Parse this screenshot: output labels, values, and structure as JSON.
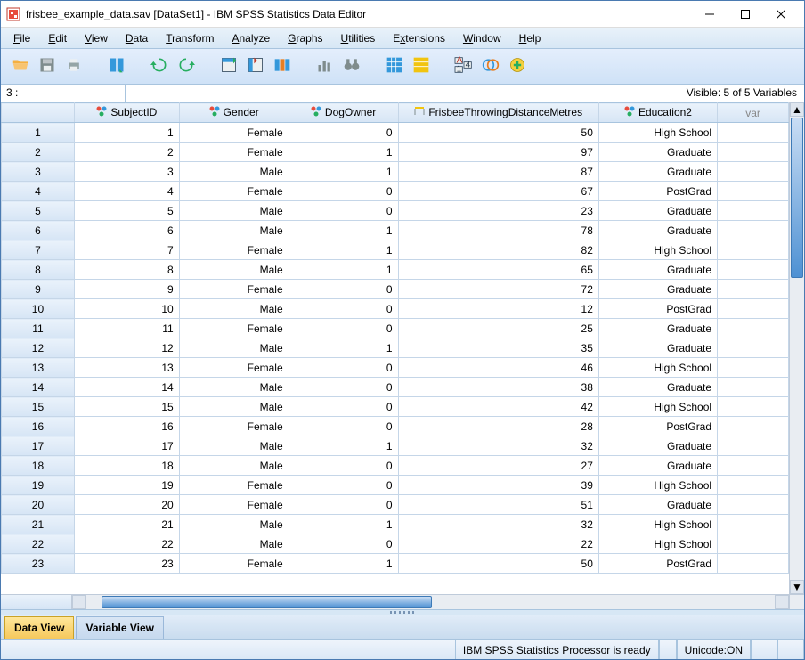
{
  "window": {
    "title": "frisbee_example_data.sav [DataSet1] - IBM SPSS Statistics Data Editor"
  },
  "menu": [
    "File",
    "Edit",
    "View",
    "Data",
    "Transform",
    "Analyze",
    "Graphs",
    "Utilities",
    "Extensions",
    "Window",
    "Help"
  ],
  "info": {
    "cell_address": "3 :",
    "visible": "Visible: 5 of 5 Variables"
  },
  "columns": [
    {
      "name": "SubjectID",
      "type": "nominal"
    },
    {
      "name": "Gender",
      "type": "nominal"
    },
    {
      "name": "DogOwner",
      "type": "nominal"
    },
    {
      "name": "FrisbeeThrowingDistanceMetres",
      "type": "scale"
    },
    {
      "name": "Education2",
      "type": "nominal"
    }
  ],
  "var_header": "var",
  "rows": [
    {
      "n": "1",
      "SubjectID": "1",
      "Gender": "Female",
      "DogOwner": "0",
      "Frisbee": "50",
      "Education2": "High School"
    },
    {
      "n": "2",
      "SubjectID": "2",
      "Gender": "Female",
      "DogOwner": "1",
      "Frisbee": "97",
      "Education2": "Graduate"
    },
    {
      "n": "3",
      "SubjectID": "3",
      "Gender": "Male",
      "DogOwner": "1",
      "Frisbee": "87",
      "Education2": "Graduate"
    },
    {
      "n": "4",
      "SubjectID": "4",
      "Gender": "Female",
      "DogOwner": "0",
      "Frisbee": "67",
      "Education2": "PostGrad"
    },
    {
      "n": "5",
      "SubjectID": "5",
      "Gender": "Male",
      "DogOwner": "0",
      "Frisbee": "23",
      "Education2": "Graduate"
    },
    {
      "n": "6",
      "SubjectID": "6",
      "Gender": "Male",
      "DogOwner": "1",
      "Frisbee": "78",
      "Education2": "Graduate"
    },
    {
      "n": "7",
      "SubjectID": "7",
      "Gender": "Female",
      "DogOwner": "1",
      "Frisbee": "82",
      "Education2": "High School"
    },
    {
      "n": "8",
      "SubjectID": "8",
      "Gender": "Male",
      "DogOwner": "1",
      "Frisbee": "65",
      "Education2": "Graduate"
    },
    {
      "n": "9",
      "SubjectID": "9",
      "Gender": "Female",
      "DogOwner": "0",
      "Frisbee": "72",
      "Education2": "Graduate"
    },
    {
      "n": "10",
      "SubjectID": "10",
      "Gender": "Male",
      "DogOwner": "0",
      "Frisbee": "12",
      "Education2": "PostGrad"
    },
    {
      "n": "11",
      "SubjectID": "11",
      "Gender": "Female",
      "DogOwner": "0",
      "Frisbee": "25",
      "Education2": "Graduate"
    },
    {
      "n": "12",
      "SubjectID": "12",
      "Gender": "Male",
      "DogOwner": "1",
      "Frisbee": "35",
      "Education2": "Graduate"
    },
    {
      "n": "13",
      "SubjectID": "13",
      "Gender": "Female",
      "DogOwner": "0",
      "Frisbee": "46",
      "Education2": "High School"
    },
    {
      "n": "14",
      "SubjectID": "14",
      "Gender": "Male",
      "DogOwner": "0",
      "Frisbee": "38",
      "Education2": "Graduate"
    },
    {
      "n": "15",
      "SubjectID": "15",
      "Gender": "Male",
      "DogOwner": "0",
      "Frisbee": "42",
      "Education2": "High School"
    },
    {
      "n": "16",
      "SubjectID": "16",
      "Gender": "Female",
      "DogOwner": "0",
      "Frisbee": "28",
      "Education2": "PostGrad"
    },
    {
      "n": "17",
      "SubjectID": "17",
      "Gender": "Male",
      "DogOwner": "1",
      "Frisbee": "32",
      "Education2": "Graduate"
    },
    {
      "n": "18",
      "SubjectID": "18",
      "Gender": "Male",
      "DogOwner": "0",
      "Frisbee": "27",
      "Education2": "Graduate"
    },
    {
      "n": "19",
      "SubjectID": "19",
      "Gender": "Female",
      "DogOwner": "0",
      "Frisbee": "39",
      "Education2": "High School"
    },
    {
      "n": "20",
      "SubjectID": "20",
      "Gender": "Female",
      "DogOwner": "0",
      "Frisbee": "51",
      "Education2": "Graduate"
    },
    {
      "n": "21",
      "SubjectID": "21",
      "Gender": "Male",
      "DogOwner": "1",
      "Frisbee": "32",
      "Education2": "High School"
    },
    {
      "n": "22",
      "SubjectID": "22",
      "Gender": "Male",
      "DogOwner": "0",
      "Frisbee": "22",
      "Education2": "High School"
    },
    {
      "n": "23",
      "SubjectID": "23",
      "Gender": "Female",
      "DogOwner": "1",
      "Frisbee": "50",
      "Education2": "PostGrad"
    }
  ],
  "tabs": {
    "data_view": "Data View",
    "variable_view": "Variable View"
  },
  "status": {
    "processor": "IBM SPSS Statistics Processor is ready",
    "unicode": "Unicode:ON"
  }
}
